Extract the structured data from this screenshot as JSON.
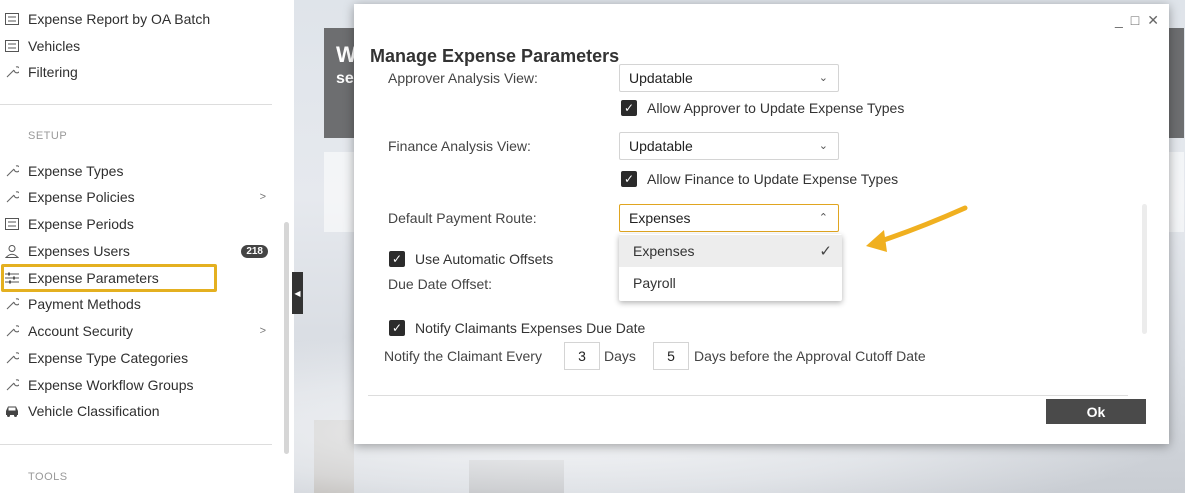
{
  "sidebar": {
    "top_items": [
      {
        "label": "Expense Report by OA Batch",
        "icon": "list-icon"
      },
      {
        "label": "Vehicles",
        "icon": "list-icon"
      },
      {
        "label": "Filtering",
        "icon": "wrench-icon"
      }
    ],
    "setup_label": "SETUP",
    "setup_items": [
      {
        "label": "Expense Types",
        "icon": "wrench-icon"
      },
      {
        "label": "Expense Policies",
        "icon": "wrench-icon",
        "chevron": ">"
      },
      {
        "label": "Expense Periods",
        "icon": "list-icon"
      },
      {
        "label": "Expenses Users",
        "icon": "user-icon",
        "badge": "218"
      },
      {
        "label": "Expense Parameters",
        "icon": "sliders-icon"
      },
      {
        "label": "Payment Methods",
        "icon": "wrench-icon"
      },
      {
        "label": "Account Security",
        "icon": "wrench-icon",
        "chevron": ">"
      },
      {
        "label": "Expense Type Categories",
        "icon": "wrench-icon"
      },
      {
        "label": "Expense Workflow Groups",
        "icon": "wrench-icon"
      },
      {
        "label": "Vehicle Classification",
        "icon": "car-icon"
      }
    ],
    "tools_label": "TOOLS"
  },
  "background": {
    "banner_line1": "W",
    "banner_line2": "se"
  },
  "dialog": {
    "title": "Manage Expense Parameters",
    "window_controls": [
      "_",
      "□",
      "✕"
    ],
    "approver_label": "Approver Analysis View:",
    "approver_value": "Updatable",
    "allow_approver_label": "Allow Approver to Update Expense Types",
    "finance_label": "Finance Analysis View:",
    "finance_value": "Updatable",
    "allow_finance_label": "Allow Finance to Update Expense Types",
    "payment_route_label": "Default Payment Route:",
    "payment_route_value": "Expenses",
    "payment_route_options": [
      "Expenses",
      "Payroll"
    ],
    "use_offsets_label": "Use Automatic Offsets",
    "due_date_offset_label": "Due Date Offset:",
    "notify_label": "Notify Claimants Expenses Due Date",
    "notify_every_label": "Notify the Claimant Every",
    "notify_every_value": "3",
    "days_label": "Days",
    "days_before_value": "5",
    "days_before_label": "Days before the Approval Cutoff Date",
    "ok_label": "Ok"
  },
  "colors": {
    "highlight": "#e4b020",
    "arrow": "#f0b020",
    "ok_button": "#4a4a4a"
  }
}
